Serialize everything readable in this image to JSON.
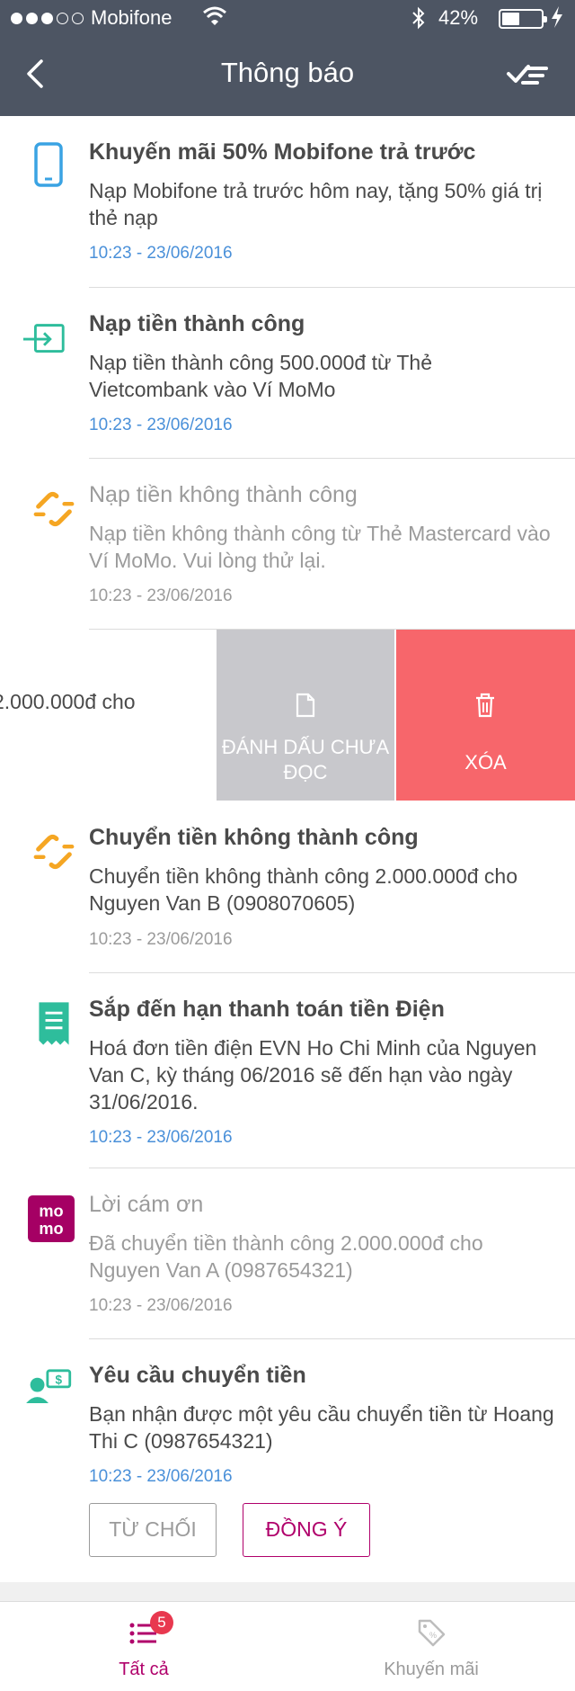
{
  "status_bar": {
    "carrier": "Mobifone",
    "battery": "42%"
  },
  "nav": {
    "title": "Thông báo"
  },
  "notifications": [
    {
      "title": "Khuyến mãi 50% Mobifone trả trước",
      "body": "Nạp Mobifone trả trước hôm nay, tặng 50% giá trị thẻ nạp",
      "time": "10:23 - 23/06/2016",
      "icon": "phone-icon"
    },
    {
      "title": "Nạp tiền thành công",
      "body": "Nạp tiền thành công 500.000đ từ Thẻ Vietcombank vào Ví MoMo",
      "time": "10:23 - 23/06/2016",
      "icon": "card-transfer-icon"
    },
    {
      "title": "Nạp tiền không thành công",
      "body": "Nạp tiền không thành công từ Thẻ Mastercard vào Ví MoMo. Vui lòng thử lại.",
      "time": "10:23 - 23/06/2016",
      "icon": "broken-link-icon"
    },
    {
      "title": "Chuyển tiền không thành công",
      "body": "Chuyển tiền không thành công 2.000.000đ cho Nguyen Van B (0908070605)",
      "time": "10:23 - 23/06/2016",
      "icon": "broken-link-icon"
    },
    {
      "title": "Sắp đến hạn thanh toán tiền Điện",
      "body": "Hoá đơn tiền điện EVN Ho Chi Minh của Nguyen Van C, kỳ tháng 06/2016 sẽ đến hạn vào ngày 31/06/2016.",
      "time": "10:23 - 23/06/2016",
      "icon": "receipt-icon"
    },
    {
      "title": "Lời cám ơn",
      "body": "Đã chuyển tiền thành công 2.000.000đ cho Nguyen Van A (0987654321)",
      "time": "10:23 - 23/06/2016",
      "icon": "momo-logo-icon"
    },
    {
      "title": "Yêu cầu chuyển tiền",
      "body": "Bạn nhận được một yêu cầu chuyển tiền từ Hoang Thi C (0987654321)",
      "time": "10:23 - 23/06/2016",
      "icon": "money-request-icon"
    }
  ],
  "swiped_row": {
    "partial_text": "2.000.000đ cho",
    "mark_unread_label": "ĐÁNH DẤU CHƯA ĐỌC",
    "delete_label": "XÓA"
  },
  "request_actions": {
    "reject_label": "TỪ CHỐI",
    "accept_label": "ĐỒNG Ý"
  },
  "tabs": {
    "all_label": "Tất cả",
    "all_badge": "5",
    "promo_label": "Khuyến mãi"
  },
  "colors": {
    "header_bg": "#4d5563",
    "accent": "#b0006b",
    "link_time": "#4a90d9",
    "delete_red": "#f7666b",
    "mark_gray": "#c8c8cc",
    "teal_icon": "#2ebd9c",
    "orange_icon": "#f5a623",
    "blue_icon": "#3aa3e3"
  }
}
